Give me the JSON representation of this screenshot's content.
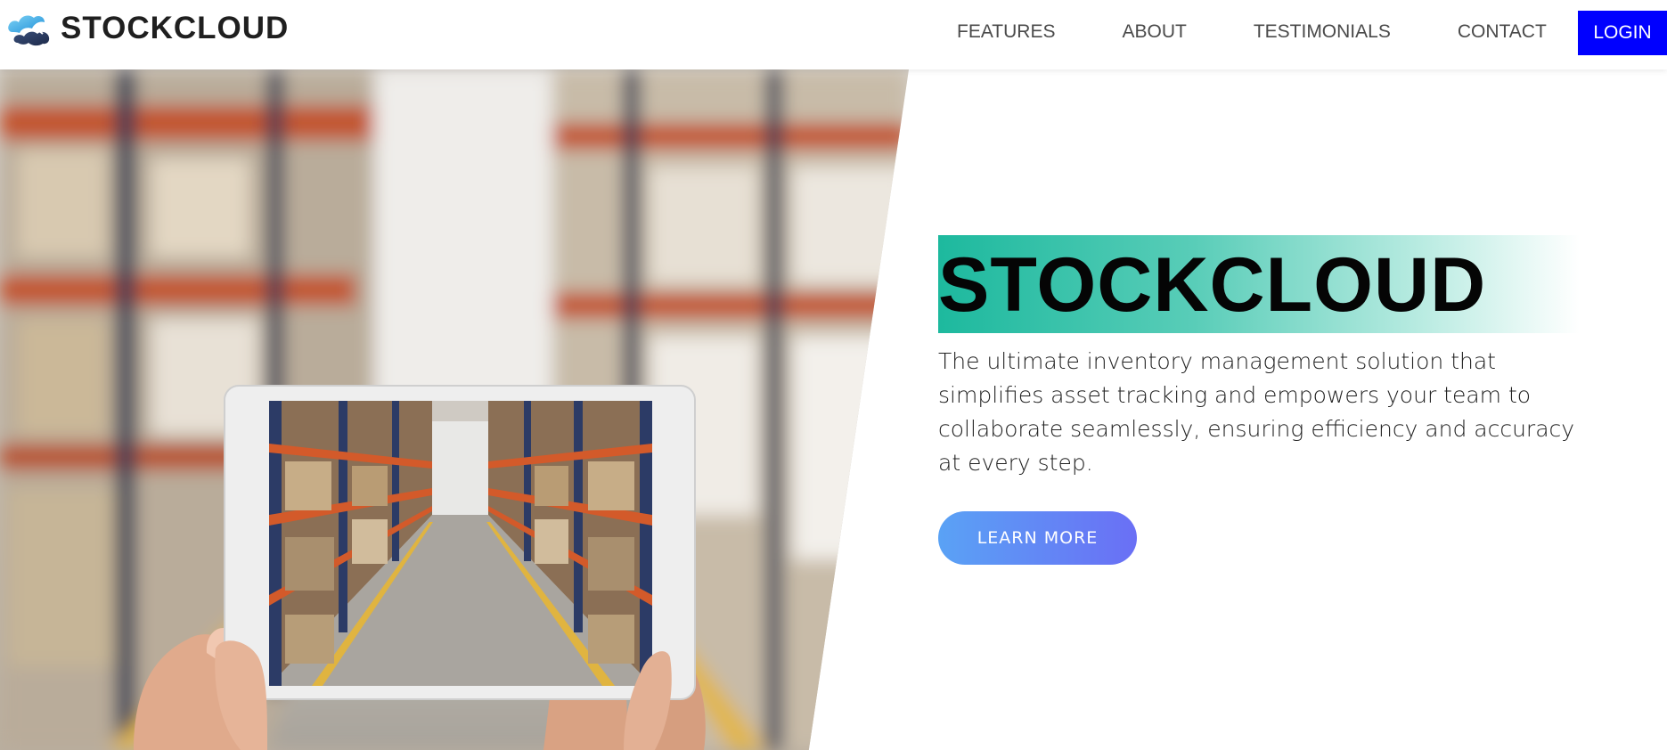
{
  "brand": {
    "name": "STOCKCLOUD",
    "logo_icon": "cloud-logo-icon"
  },
  "nav": {
    "links": [
      {
        "label": "FEATURES"
      },
      {
        "label": "ABOUT"
      },
      {
        "label": "TESTIMONIALS"
      },
      {
        "label": "CONTACT"
      }
    ],
    "login_label": "LOGIN"
  },
  "hero": {
    "title": "STOCKCLOUD",
    "description": "The ultimate inventory management solution that simplifies asset tracking and empowers your team to collaborate seamlessly, ensuring efficiency and accuracy at every step.",
    "cta_label": "LEARN MORE",
    "image_subject": "warehouse-tablet-photo"
  },
  "colors": {
    "login_button": "#0000ff",
    "title_highlight": "#1db99e",
    "cta_start": "#5aa2f5",
    "cta_end": "#6a6ff5"
  }
}
